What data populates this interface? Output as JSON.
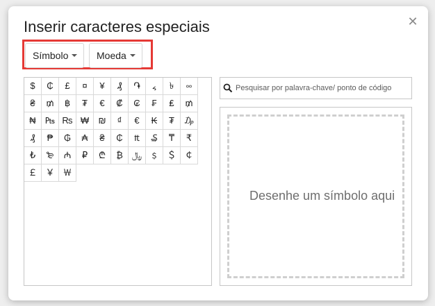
{
  "dialog": {
    "title": "Inserir caracteres especiais",
    "close_icon": "close-icon"
  },
  "filters": {
    "category": "Símbolo",
    "subcategory": "Moeda",
    "highlight_color": "#e53935"
  },
  "symbols": [
    "$",
    "₵",
    "£",
    "¤",
    "¥",
    "₰",
    "֏",
    "៹",
    "৳",
    "༛",
    "₴",
    "₥",
    "฿",
    "₮",
    "€",
    "₡",
    "₢",
    "₣",
    "₤",
    "₥",
    "₦",
    "₧",
    "₨",
    "₩",
    "₪",
    "₫",
    "€",
    "₭",
    "₮",
    "₯",
    "₰",
    "₱",
    "₲",
    "₳",
    "₴",
    "₵",
    "₶",
    "₷",
    "₸",
    "₹",
    "₺",
    "₻",
    "₼",
    "₽",
    "₾",
    "₿",
    "﷼",
    "﹩",
    "＄",
    "￠",
    "￡",
    "￥",
    "￦"
  ],
  "search": {
    "placeholder": "Pesquisar por palavra-chave/ ponto de código"
  },
  "draw": {
    "hint": "Desenhe um símbolo aqui"
  }
}
